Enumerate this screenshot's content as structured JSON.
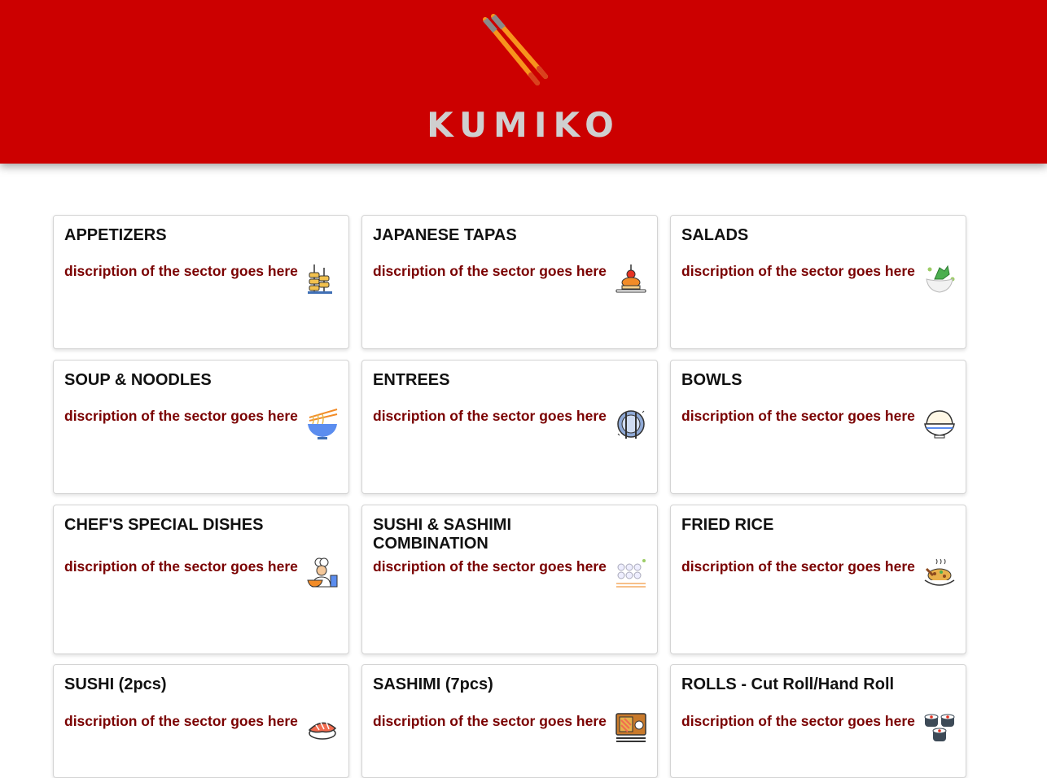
{
  "brand": {
    "name": "KUMIKO",
    "logo_icon": "chopsticks-icon",
    "header_color": "#cc0000",
    "title_color": "#cfcfcf"
  },
  "description_color": "#7a0000",
  "categories": [
    {
      "title": "APPETIZERS",
      "description": "discription of the sector goes here",
      "icon": "skewers-icon"
    },
    {
      "title": "JAPANESE TAPAS",
      "description": "discription of the sector goes here",
      "icon": "dango-plate-icon"
    },
    {
      "title": "SALADS",
      "description": "discription of the sector goes here",
      "icon": "salad-bowl-icon"
    },
    {
      "title": "SOUP & NOODLES",
      "description": "discription of the sector goes here",
      "icon": "noodle-bowl-icon"
    },
    {
      "title": "ENTREES",
      "description": "discription of the sector goes here",
      "icon": "plate-cutlery-icon"
    },
    {
      "title": "BOWLS",
      "description": "discription of the sector goes here",
      "icon": "rice-bowl-icon"
    },
    {
      "title": "CHEF'S SPECIAL DISHES",
      "description": "discription of the sector goes here",
      "icon": "chef-icon"
    },
    {
      "title": "SUSHI & SASHIMI COMBINATION",
      "description": "discription of the sector goes here",
      "icon": "sushi-platter-icon"
    },
    {
      "title": "FRIED RICE",
      "description": "discription of the sector goes here",
      "icon": "fried-rice-icon"
    },
    {
      "title": "SUSHI (2pcs)",
      "description": "discription of the sector goes here",
      "icon": "nigiri-icon"
    },
    {
      "title": "SASHIMI (7pcs)",
      "description": "discription of the sector goes here",
      "icon": "sashimi-board-icon"
    },
    {
      "title": "ROLLS - Cut Roll/Hand Roll",
      "description": "discription of the sector goes here",
      "icon": "maki-rolls-icon"
    }
  ]
}
